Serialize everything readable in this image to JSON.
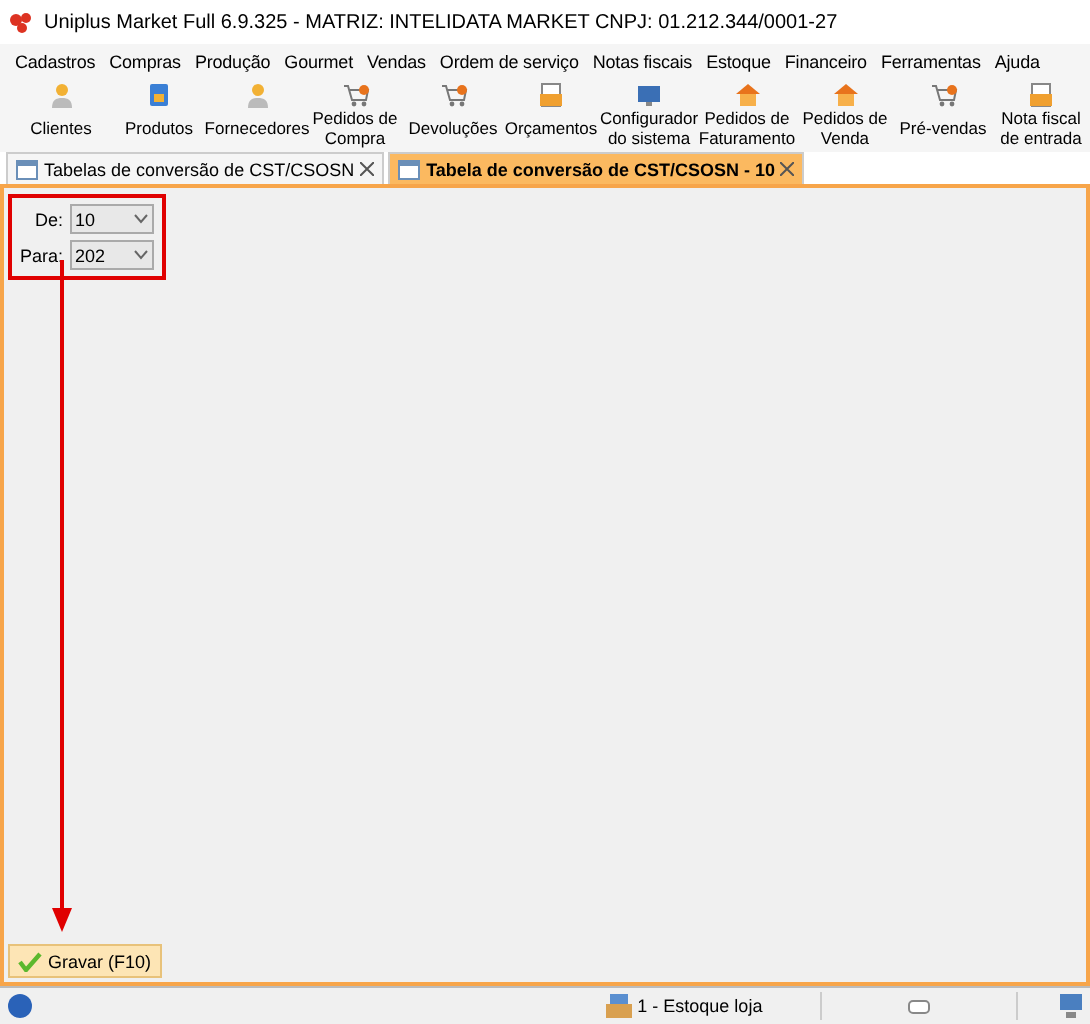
{
  "window": {
    "title": "Uniplus Market Full 6.9.325 - MATRIZ: INTELIDATA MARKET CNPJ: 01.212.344/0001-27"
  },
  "menu": [
    "Cadastros",
    "Compras",
    "Produção",
    "Gourmet",
    "Vendas",
    "Ordem de serviço",
    "Notas fiscais",
    "Estoque",
    "Financeiro",
    "Ferramentas",
    "Ajuda"
  ],
  "toolbar": [
    {
      "lines": [
        "Clientes"
      ],
      "kind": "person"
    },
    {
      "lines": [
        "Produtos"
      ],
      "kind": "box"
    },
    {
      "lines": [
        "Fornecedores"
      ],
      "kind": "person"
    },
    {
      "lines": [
        "Pedidos de",
        "Compra"
      ],
      "kind": "cart"
    },
    {
      "lines": [
        "Devoluções"
      ],
      "kind": "cart"
    },
    {
      "lines": [
        "Orçamentos"
      ],
      "kind": "doc"
    },
    {
      "lines": [
        "Configurador",
        "do sistema"
      ],
      "kind": "screen"
    },
    {
      "lines": [
        "Pedidos de",
        "Faturamento"
      ],
      "kind": "house"
    },
    {
      "lines": [
        "Pedidos de",
        "Venda"
      ],
      "kind": "house"
    },
    {
      "lines": [
        "Pré-vendas"
      ],
      "kind": "cart"
    },
    {
      "lines": [
        "Nota fiscal",
        "de entrada"
      ],
      "kind": "doc"
    }
  ],
  "tabs": [
    {
      "label": "Tabelas de conversão de CST/CSOSN",
      "selected": false
    },
    {
      "label": "Tabela de conversão de CST/CSOSN - 10",
      "selected": true
    }
  ],
  "form": {
    "fields": [
      {
        "label": "De:",
        "value": "10"
      },
      {
        "label": "Para:",
        "value": "202"
      }
    ]
  },
  "save_button": "Gravar (F10)",
  "status_bar": {
    "stock": "1 - Estoque loja"
  }
}
